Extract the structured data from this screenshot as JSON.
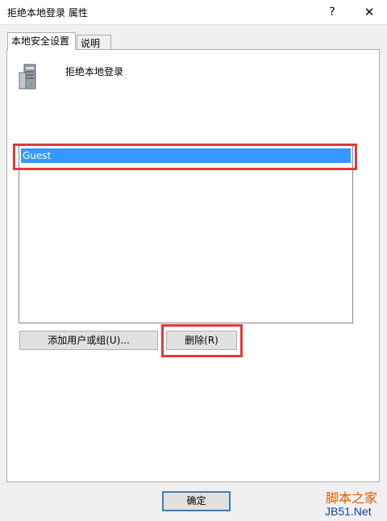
{
  "window": {
    "title": "拒绝本地登录 属性",
    "help_glyph": "?",
    "close_glyph": "✕"
  },
  "tabs": [
    {
      "label": "本地安全设置",
      "active": true
    },
    {
      "label": "说明",
      "active": false
    }
  ],
  "policy": {
    "name": "拒绝本地登录",
    "icon": "server-icon"
  },
  "user_list": {
    "items": [
      "Guest"
    ],
    "selected": "Guest"
  },
  "buttons": {
    "add_label": "添加用户或组(U)...",
    "remove_label": "删除(R)",
    "ok_label": "确定"
  },
  "watermark": {
    "top": "脚本之家",
    "bottom": "JB51.Net"
  },
  "colors": {
    "highlight_red": "#e03a3a",
    "selection_blue": "#3399ff"
  }
}
